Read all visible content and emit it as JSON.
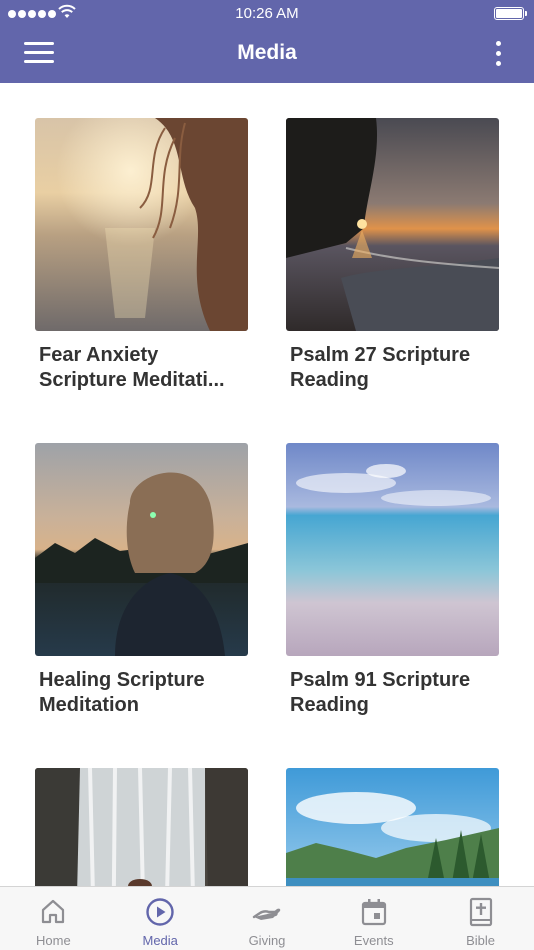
{
  "status_bar": {
    "time": "10:26 AM"
  },
  "header": {
    "title": "Media"
  },
  "media_items": [
    {
      "title_line1": "Fear Anxiety",
      "title_line2": "Scripture Meditati..."
    },
    {
      "title_line1": "Psalm 27 Scripture",
      "title_line2": "Reading"
    },
    {
      "title_line1": "Healing Scripture",
      "title_line2": "Meditation"
    },
    {
      "title_line1": "Psalm 91 Scripture",
      "title_line2": "Reading"
    },
    {
      "title_line1": "",
      "title_line2": ""
    },
    {
      "title_line1": "",
      "title_line2": ""
    }
  ],
  "tab_bar": {
    "items": [
      {
        "label": "Home",
        "icon": "home-icon",
        "active": false
      },
      {
        "label": "Media",
        "icon": "play-circle-icon",
        "active": true
      },
      {
        "label": "Giving",
        "icon": "giving-hand-icon",
        "active": false
      },
      {
        "label": "Events",
        "icon": "calendar-icon",
        "active": false
      },
      {
        "label": "Bible",
        "icon": "bible-icon",
        "active": false
      }
    ]
  },
  "colors": {
    "brand": "#6266ab",
    "tab_inactive": "#8e8e93",
    "title_text": "#333333"
  }
}
